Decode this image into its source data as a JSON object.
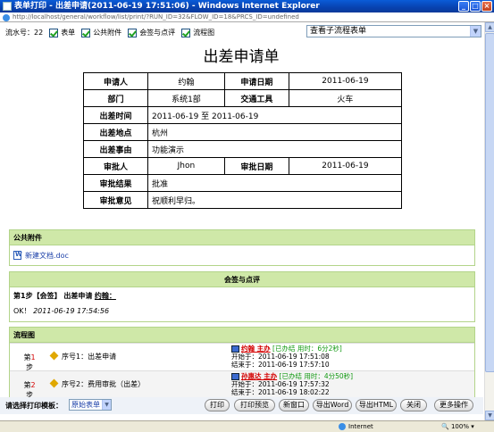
{
  "window": {
    "title": "表单打印 - 出差申请(2011-06-19 17:51:06) - Windows Internet Explorer",
    "address": "http://localhost/general/workflow/list/print/?RUN_ID=32&FLOW_ID=18&PRCS_ID=undefined"
  },
  "filter": {
    "serial_label": "流水号：22",
    "options": [
      "表单",
      "公共附件",
      "会签与点评",
      "流程图"
    ]
  },
  "subflow_select": "查看子流程表单",
  "form": {
    "title": "出差申请单",
    "applicant_label": "申请人",
    "applicant": "约翰",
    "apply_date_label": "申请日期",
    "apply_date": "2011-06-19",
    "dept_label": "部门",
    "dept": "系统1部",
    "transport_label": "交通工具",
    "transport": "火车",
    "time_label": "出差时间",
    "time": "2011-06-19 至 2011-06-19",
    "place_label": "出差地点",
    "place": "杭州",
    "reason_label": "出差事由",
    "reason": "功能演示",
    "approver_label": "审批人",
    "approver": "Jhon",
    "approve_date_label": "审批日期",
    "approve_date": "2011-06-19",
    "result_label": "审批结果",
    "result": "批准",
    "opinion_label": "审批意见",
    "opinion": "祝顺利早归。"
  },
  "attachments": {
    "header": "公共附件",
    "file": "新建文档.doc"
  },
  "review": {
    "header": "会签与点评",
    "step": "第1步【会签】 出差申请",
    "user": "约翰：",
    "content": "OK！",
    "time": "2011-06-19 17:54:56"
  },
  "flowchart": {
    "header": "流程图",
    "rows": [
      {
        "num_prefix": "第",
        "num": "1",
        "num_suffix": "步",
        "name": "序号1：出差申请",
        "who": "约翰 主办",
        "status": "[已办结 用时：6分2秒]",
        "start": "开始于：2011-06-19 17:51:08",
        "end": "结束于：2011-06-19 17:57:10"
      },
      {
        "num_prefix": "第",
        "num": "2",
        "num_suffix": "步",
        "name": "序号2：费用审批（出差）",
        "who": "孙惠达 主办",
        "status": "[已办结 用时：4分50秒]",
        "start": "开始于：2011-06-19 17:57:32",
        "end": "结束于：2011-06-19 18:02:22"
      }
    ]
  },
  "bottom": {
    "template_label": "请选择打印模板：",
    "template_value": "原始表单",
    "buttons": [
      "打印",
      "打印预览",
      "新窗口",
      "导出Word",
      "导出HTML",
      "关闭",
      "更多操作"
    ]
  },
  "status": {
    "zone": "Internet",
    "zoom": "100%"
  }
}
